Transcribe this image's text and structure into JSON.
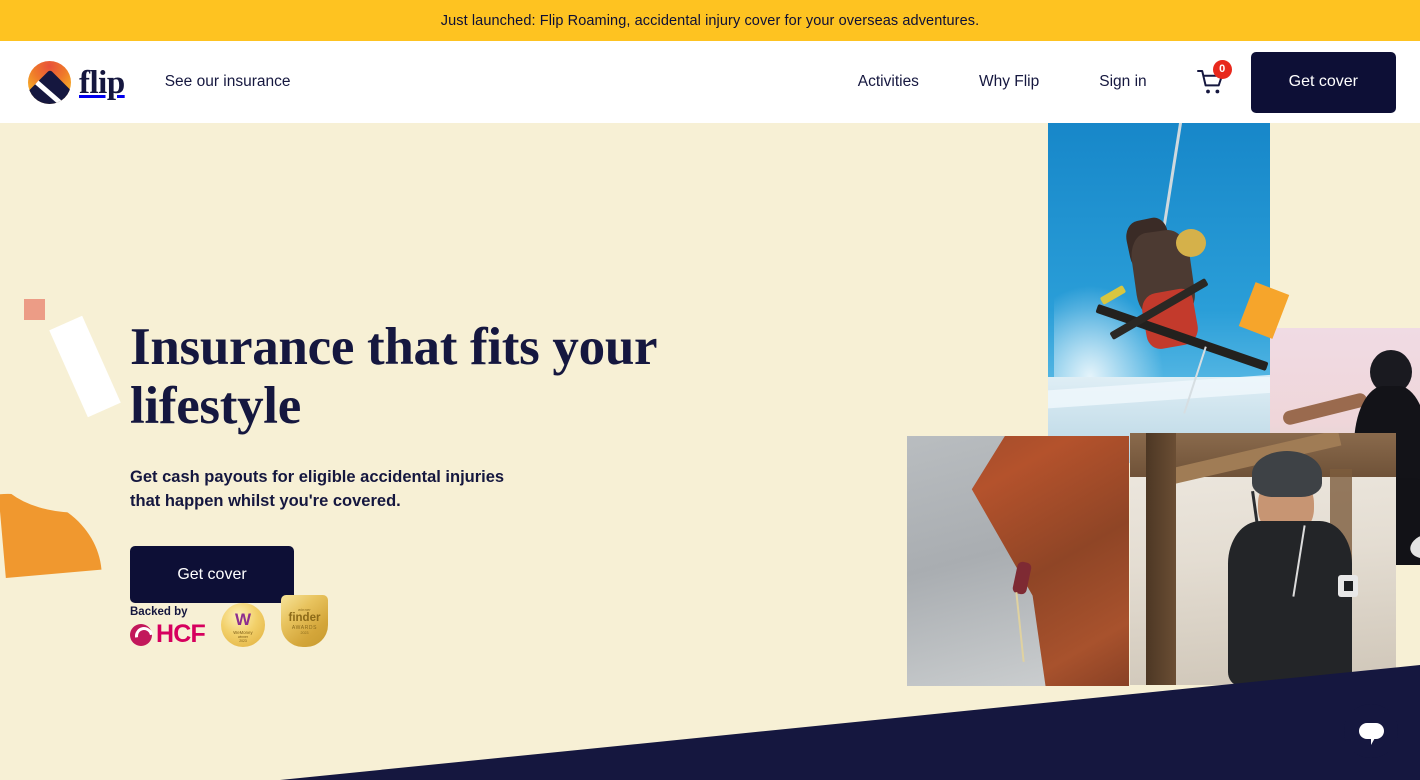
{
  "announcement": {
    "text": "Just launched: Flip Roaming, accidental injury cover for your overseas adventures.",
    "bg_color": "#fec321",
    "text_color": "#0d0f36"
  },
  "header": {
    "logo": {
      "icon_name": "flip-logo-mark",
      "wordmark": "flip"
    },
    "left_nav": [
      {
        "label": "See our insurance"
      }
    ],
    "right_nav": [
      {
        "label": "Activities"
      },
      {
        "label": "Why Flip"
      },
      {
        "label": "Sign in"
      }
    ],
    "cart": {
      "icon_name": "shopping-cart-icon",
      "badge_count": "0",
      "badge_color": "#e8281c"
    },
    "cta": {
      "label": "Get cover",
      "bg_color": "#0d0f36",
      "text_color": "#ffffff"
    }
  },
  "hero": {
    "title": "Insurance that fits your lifestyle",
    "subtitle": "Get cash payouts for eligible accidental injuries that happen whilst you're covered.",
    "cta_label": "Get cover",
    "background_color": "#f7f0d5",
    "title_color": "#15173f",
    "backed_by": {
      "label": "Backed by",
      "partner": "HCF",
      "partner_color": "#d6005e",
      "awards": [
        {
          "name": "WeMoney",
          "mark": "W",
          "line1": "WeMoney",
          "line2": "winner",
          "line3": "2023"
        },
        {
          "name": "finder AWARDS",
          "top": "winner",
          "mark": "finder",
          "line1": "AWARDS",
          "line2": "2023"
        }
      ]
    },
    "decorations": [
      {
        "name": "coral-square",
        "color": "#ec9c86"
      },
      {
        "name": "white-rectangle",
        "color": "#ffffff"
      },
      {
        "name": "orange-arc",
        "color": "#f0982f"
      },
      {
        "name": "orange-rectangle",
        "color": "#f6a52b"
      },
      {
        "name": "yellow-ring",
        "color": "#fec321"
      }
    ],
    "photos": [
      {
        "name": "skier-photo",
        "alt": "Skier jumping against blue sky"
      },
      {
        "name": "runner-photo",
        "alt": "Runner with arms outstretched at sunset"
      },
      {
        "name": "rock-climber-photo",
        "alt": "Rock climber on red cliff face"
      },
      {
        "name": "skater-photo",
        "alt": "Man wearing helmet and backpack"
      }
    ]
  },
  "chat": {
    "icon_name": "chat-bubble-icon",
    "bg_color": "#15173f"
  }
}
